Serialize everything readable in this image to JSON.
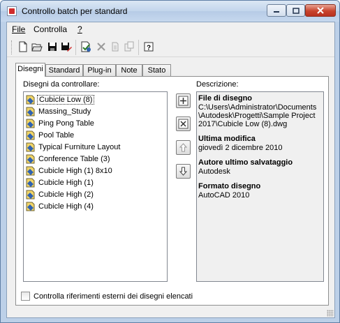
{
  "window": {
    "title": "Controllo batch per standard"
  },
  "menu": {
    "file": "File",
    "check": "Controlla",
    "help": "?"
  },
  "toolbar": [
    "new-icon",
    "open-icon",
    "save-icon",
    "save-as-icon",
    "check-icon",
    "delete-icon",
    "copy-icon",
    "paste-icon",
    "help-icon"
  ],
  "tabs": [
    "Disegni",
    "Standard",
    "Plug-in",
    "Note",
    "Stato"
  ],
  "drawings": {
    "label": "Disegni da controllare:",
    "items": [
      "Cubicle Low (8)",
      "Massing_Study",
      "Ping Pong Table",
      "Pool Table",
      "Typical Furniture Layout",
      "Conference Table (3)",
      "Cubicle High (1) 8x10",
      "Cubicle High (1)",
      "Cubicle High (2)",
      "Cubicle High (4)"
    ],
    "selected_index": 0
  },
  "description": {
    "label": "Descrizione:",
    "sections": [
      {
        "heading": "File di disegno",
        "lines": [
          "C:\\Users\\Administrator\\Documents",
          "\\Autodesk\\Progetti\\Sample Project",
          "2017\\Cubicle Low (8).dwg"
        ]
      },
      {
        "heading": "Ultima modifica",
        "lines": [
          "giovedì 2 dicembre 2010"
        ]
      },
      {
        "heading": "Autore ultimo salvataggio",
        "lines": [
          "Autodesk"
        ]
      },
      {
        "heading": "Formato disegno",
        "lines": [
          "AutoCAD 2010"
        ]
      }
    ]
  },
  "side_buttons": [
    "add-drawing-button",
    "remove-drawing-button",
    "move-up-button",
    "move-down-button"
  ],
  "xref_checkbox": {
    "label": "Controlla riferimenti esterni dei disegni elencati",
    "checked": false
  },
  "colors": {
    "accent": "#d02b2b",
    "panel": "#f0f0f0",
    "title_gradient_top": "#dbe7f4"
  }
}
